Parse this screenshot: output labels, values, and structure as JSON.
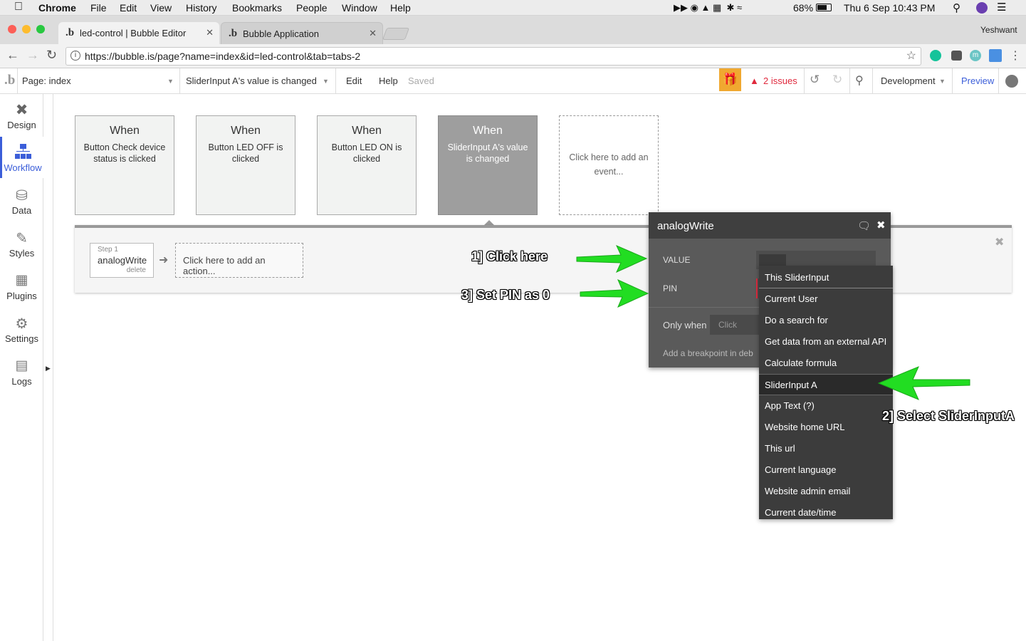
{
  "menubar": {
    "app": "Chrome",
    "items": [
      "File",
      "Edit",
      "View",
      "History",
      "Bookmarks",
      "People",
      "Window",
      "Help"
    ],
    "battery": "68%",
    "datetime": "Thu 6 Sep  10:43 PM"
  },
  "tabs": [
    {
      "title": "led-control | Bubble Editor",
      "active": true
    },
    {
      "title": "Bubble Application",
      "active": false
    }
  ],
  "profile_name": "Yeshwant",
  "url": "https://bubble.is/page?name=index&id=led-control&tab=tabs-2",
  "bubble_bar": {
    "page": "Page: index",
    "workflow": "SliderInput A's value is changed",
    "edit": "Edit",
    "help": "Help",
    "saved": "Saved",
    "issues": "2 issues",
    "environment": "Development",
    "preview": "Preview"
  },
  "sidebar": [
    {
      "label": "Design",
      "icon": "design-icon"
    },
    {
      "label": "Workflow",
      "icon": "workflow-icon",
      "active": true
    },
    {
      "label": "Data",
      "icon": "database-icon"
    },
    {
      "label": "Styles",
      "icon": "brush-icon"
    },
    {
      "label": "Plugins",
      "icon": "plugin-icon"
    },
    {
      "label": "Settings",
      "icon": "gear-icon"
    },
    {
      "label": "Logs",
      "icon": "document-icon"
    }
  ],
  "events": [
    {
      "when": "When",
      "desc": "Button Check device status is clicked"
    },
    {
      "when": "When",
      "desc": "Button LED OFF is clicked"
    },
    {
      "when": "When",
      "desc": "Button LED ON is clicked"
    },
    {
      "when": "When",
      "desc": "SliderInput A's value is changed",
      "selected": true
    }
  ],
  "add_event": "Click here to add an event...",
  "step": {
    "label": "Step 1",
    "name": "analogWrite",
    "delete": "delete"
  },
  "add_action": "Click here to add an action...",
  "popup": {
    "title": "analogWrite",
    "value_label": "VALUE",
    "pin_label": "PIN",
    "only_when": "Only when",
    "only_when_placeholder": "Click",
    "breakpoint": "Add a breakpoint in deb"
  },
  "dropdown": [
    "This SliderInput",
    "Current User",
    "Do a search for",
    "Get data from an external API",
    "Calculate formula",
    "SliderInput A",
    "App Text (?)",
    "Website home URL",
    "This url",
    "Current language",
    "Website admin email",
    "Current date/time"
  ],
  "annotations": {
    "a1": "1] Click here",
    "a2": "2] Select SliderInputA",
    "a3": "3] Set PIN as 0"
  },
  "colors": {
    "accent": "#3b5ed9",
    "arrow": "#22dd22",
    "gift": "#f0a830",
    "issues": "#e0293d"
  }
}
